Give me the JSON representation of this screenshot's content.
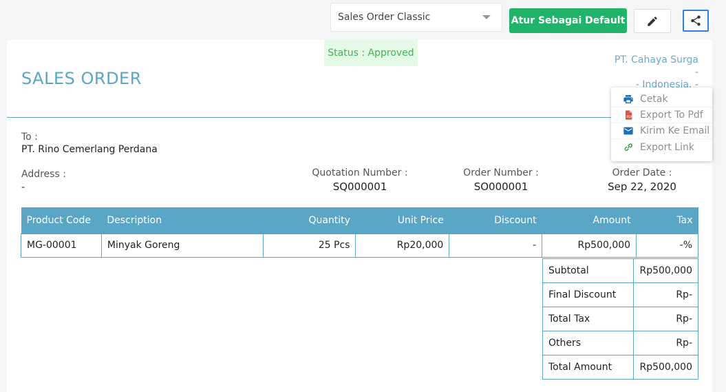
{
  "toolbar": {
    "template_select_value": "Sales Order Classic",
    "default_button_label": "Atur Sebagai Default",
    "edit_icon": "pencil-icon",
    "share_icon": "share-icon"
  },
  "status": "Status : Approved",
  "document": {
    "title": "SALES ORDER",
    "company_lines": [
      "PT. Cahaya Surga",
      "-",
      "- Indonesia, -"
    ],
    "to_label": "To :",
    "to_value": "PT. Rino Cemerlang Perdana",
    "address_label": "Address :",
    "address_value": "-",
    "quotation_number_label": "Quotation Number :",
    "quotation_number": "SQ000001",
    "order_number_label": "Order Number :",
    "order_number": "SO000001",
    "order_date_label": "Order Date :",
    "order_date": "Sep 22, 2020"
  },
  "table": {
    "headers": [
      "Product Code",
      "Description",
      "Quantity",
      "Unit Price",
      "Discount",
      "Amount",
      "Tax"
    ],
    "rows": [
      [
        "MG-00001",
        "Minyak Goreng",
        "25 Pcs",
        "Rp20,000",
        "-",
        "Rp500,000",
        "-%"
      ]
    ]
  },
  "totals": [
    {
      "label": "Subtotal",
      "value": "Rp500,000"
    },
    {
      "label": "Final Discount",
      "value": "Rp-"
    },
    {
      "label": "Total Tax",
      "value": "Rp-"
    },
    {
      "label": "Others",
      "value": "Rp-"
    },
    {
      "label": "Total Amount",
      "value": "Rp500,000"
    }
  ],
  "share_menu": {
    "items": [
      {
        "label": "Cetak",
        "icon": "printer-icon",
        "color": "#1f6fb5"
      },
      {
        "label": "Export To Pdf",
        "icon": "pdf-icon",
        "color": "#d9534f"
      },
      {
        "label": "Kirim Ke Email",
        "icon": "email-icon",
        "color": "#1f6fb5"
      },
      {
        "label": "Export Link",
        "icon": "link-icon",
        "color": "#2e8b2e"
      }
    ]
  },
  "colors": {
    "accent": "#5aa6c7",
    "primary_button": "#22b36b",
    "status_bg": "#e4f9e6",
    "status_text": "#42b558"
  }
}
